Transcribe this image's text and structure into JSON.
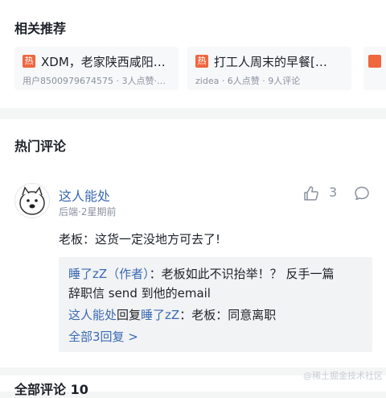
{
  "recommend": {
    "title": "相关推荐",
    "badge": "热",
    "items": [
      {
        "title": "XDM，老家陕西咸阳…",
        "meta": "用户8500979674575 · 3人点赞·…"
      },
      {
        "title": "打工人周末的早餐[…",
        "meta": "zidea · 6人点赞 · 9人评论"
      }
    ]
  },
  "hot": {
    "title": "热门评论",
    "comment": {
      "author": "这人能处",
      "meta": "后端·2星期前",
      "likes": "3",
      "text": "老板：这货一定没地方可去了!",
      "replies": [
        {
          "from": "睡了zZ（作者）",
          "sep": "：",
          "text": "老板如此不识抬举！？ 反手一篇",
          "text2": "辞职信 send 到他的email"
        },
        {
          "from": "这人能处",
          "verb": "回复",
          "to": "睡了zZ",
          "sep": "：",
          "text": "老板：同意离职"
        }
      ],
      "all_replies": "全部3回复 >"
    }
  },
  "all_comments": {
    "title": "全部评论 10"
  },
  "watermark": "@稀土掘金技术社区",
  "colors": {
    "accent": "#3b6ab3",
    "badge": "#f0663f"
  }
}
